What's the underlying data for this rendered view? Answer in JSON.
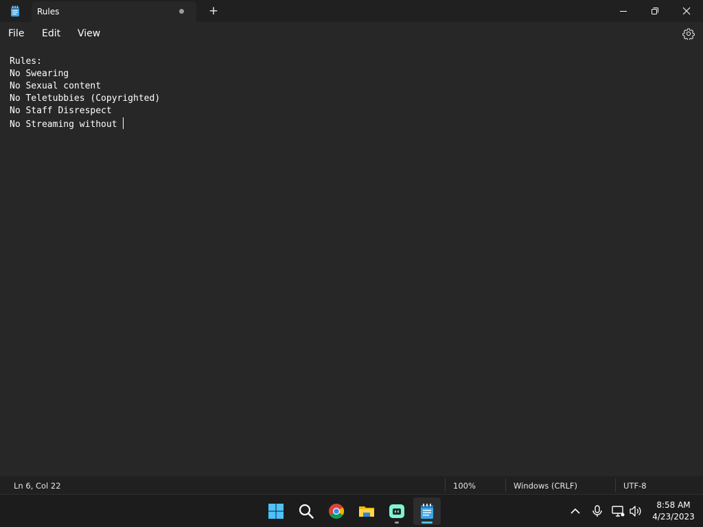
{
  "window": {
    "tab_title": "Rules",
    "new_tab_label": "+"
  },
  "menu": {
    "file": "File",
    "edit": "Edit",
    "view": "View"
  },
  "editor": {
    "lines": [
      "Rules:",
      "No Swearing",
      "No Sexual content",
      "No Teletubbies (Copyrighted)",
      "No Staff Disrespect",
      "No Streaming without "
    ]
  },
  "status": {
    "position": "Ln 6, Col 22",
    "zoom": "100%",
    "line_ending": "Windows (CRLF)",
    "encoding": "UTF-8"
  },
  "taskbar": {
    "apps": [
      "start-icon",
      "search-icon",
      "chrome-icon",
      "file-explorer-icon",
      "chat-app-icon",
      "notepad-icon"
    ],
    "tray": [
      "chevron-up-icon",
      "microphone-icon",
      "network-icon",
      "volume-icon"
    ]
  },
  "clock": {
    "time": "8:58 AM",
    "date": "4/23/2023"
  },
  "colors": {
    "background": "#272727",
    "chrome": "#202020",
    "accent": "#4cc2ff",
    "text": "#ffffff"
  }
}
